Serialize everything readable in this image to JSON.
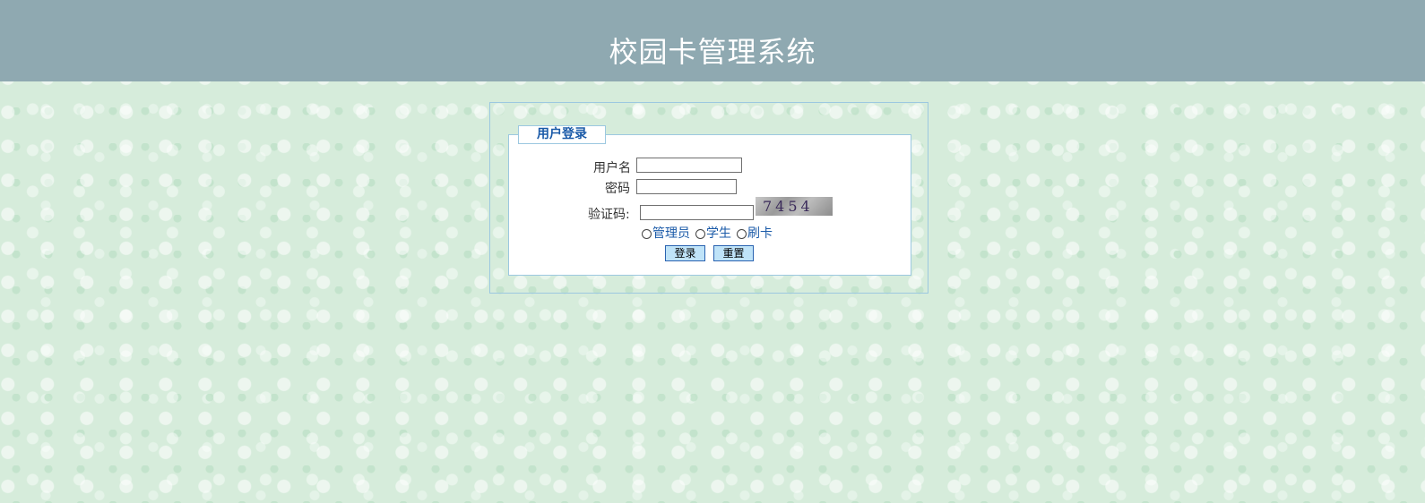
{
  "header": {
    "title": "校园卡管理系统"
  },
  "login": {
    "legend": "用户登录",
    "username_label": "用户名",
    "username_value": "",
    "password_label": "密码",
    "password_value": "",
    "captcha_label": "验证码:",
    "captcha_value": "",
    "captcha_text": "7454",
    "roles": [
      "管理员",
      "学生",
      "刷卡"
    ],
    "login_button": "登录",
    "reset_button": "重置"
  },
  "colors": {
    "header_bg": "#8fa9b1",
    "page_bg": "#d6ecdb",
    "box_border": "#9cc8e0",
    "accent": "#1a5aa8",
    "button_bg": "#bfe3f8"
  }
}
